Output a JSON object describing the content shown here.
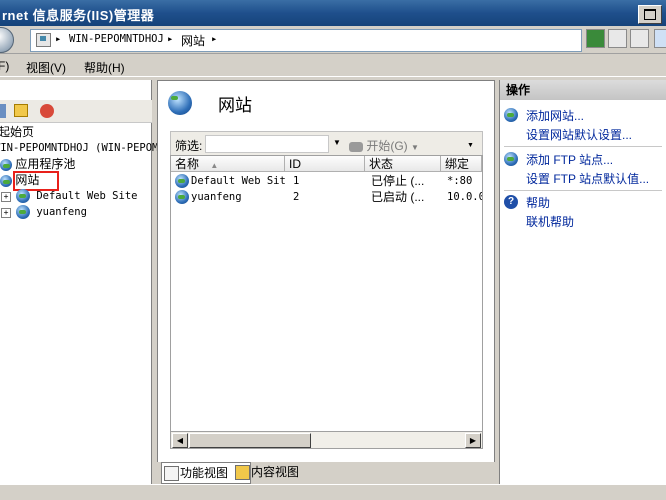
{
  "window": {
    "title": "rnet 信息服务(IIS)管理器"
  },
  "address": {
    "sep": "▸",
    "crumbs": [
      "WIN-PEPOMNTDHOJ",
      "网站"
    ]
  },
  "menu": {
    "items": [
      "F)",
      "视图(V)",
      "帮助(H)"
    ]
  },
  "tree": {
    "items": [
      {
        "label": "起始页"
      },
      {
        "label": "WIN-PEPOMNTDHOJ (WIN-PEPOM"
      },
      {
        "label": "应用程序池"
      },
      {
        "label": "网站"
      },
      {
        "label": "Default Web Site",
        "expander": "+"
      },
      {
        "label": "yuanfeng",
        "expander": "+"
      }
    ]
  },
  "center": {
    "title": "网站",
    "filter_label": "筛选:",
    "start_label": "开始(G)",
    "columns": [
      "名称",
      "ID",
      "状态",
      "绑定"
    ],
    "rows": [
      {
        "name": "Default Web Site",
        "id": "1",
        "status": "已停止 (...",
        "binding": "*:80"
      },
      {
        "name": "yuanfeng",
        "id": "2",
        "status": "已启动 (...",
        "binding": "10.0.0"
      }
    ],
    "tabs": [
      "功能视图",
      "内容视图"
    ]
  },
  "actions": {
    "header": "操作",
    "items": [
      "添加网站...",
      "设置网站默认设置...",
      "添加 FTP 站点...",
      "设置 FTP 站点默认值...",
      "帮助",
      "联机帮助"
    ]
  },
  "colors": {
    "accent": "#1f4f8c",
    "link": "#00279c",
    "highlight": "#e8201a"
  }
}
